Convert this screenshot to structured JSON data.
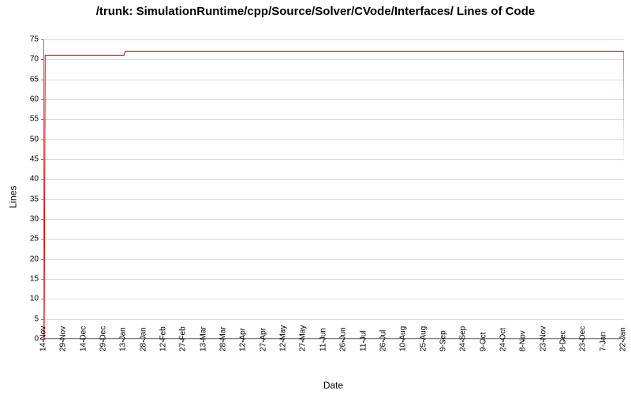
{
  "chart_data": {
    "type": "line",
    "title": "/trunk: SimulationRuntime/cpp/Source/Solver/CVode/Interfaces/ Lines of Code",
    "xlabel": "Date",
    "ylabel": "Lines",
    "ylim": [
      0,
      75
    ],
    "y_ticks": [
      0,
      5,
      10,
      15,
      20,
      25,
      30,
      35,
      40,
      45,
      50,
      55,
      60,
      65,
      70,
      75
    ],
    "categories": [
      "14-Nov",
      "29-Nov",
      "14-Dec",
      "29-Dec",
      "13-Jan",
      "28-Jan",
      "12-Feb",
      "27-Feb",
      "13-Mar",
      "28-Mar",
      "12-Apr",
      "27-Apr",
      "12-May",
      "27-May",
      "11-Jun",
      "26-Jun",
      "11-Jul",
      "26-Jul",
      "10-Aug",
      "25-Aug",
      "9-Sep",
      "24-Sep",
      "9-Oct",
      "24-Oct",
      "8-Nov",
      "23-Nov",
      "8-Dec",
      "23-Dec",
      "7-Jan",
      "22-Jan"
    ],
    "series": [
      {
        "name": "Lines of Code",
        "color": "#e00000",
        "points": [
          {
            "x_index": 0,
            "y": 0
          },
          {
            "x_index": 0.05,
            "y": 71
          },
          {
            "x_index": 4.0,
            "y": 71
          },
          {
            "x_index": 4.05,
            "y": 72
          },
          {
            "x_index": 29,
            "y": 72
          },
          {
            "x_index": 29.05,
            "y": 0
          }
        ]
      }
    ]
  }
}
